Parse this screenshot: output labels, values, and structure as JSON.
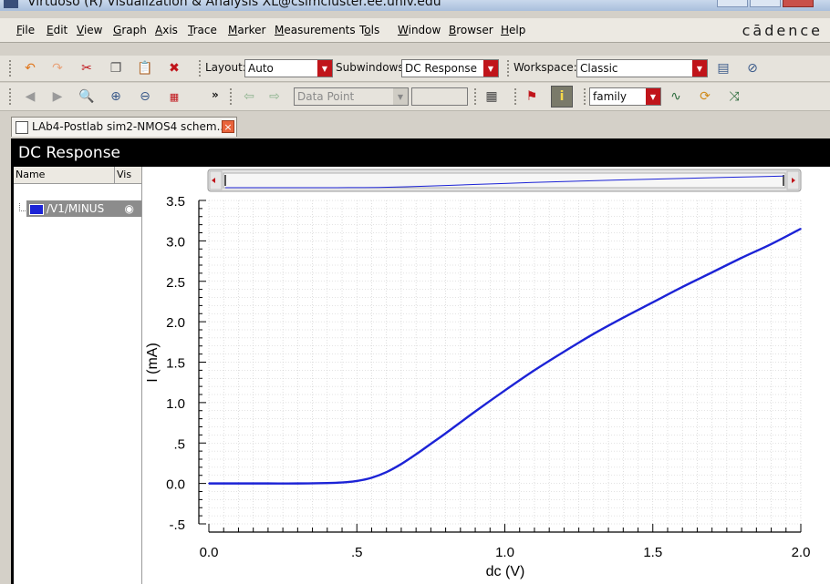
{
  "window": {
    "title": "Virtuoso (R) Visualization & Analysis XL@csimcluster.ee.univ.edu"
  },
  "menubar": {
    "items": [
      {
        "u": "F",
        "rest": "ile"
      },
      {
        "u": "E",
        "rest": "dit"
      },
      {
        "u": "V",
        "rest": "iew"
      },
      {
        "u": "G",
        "rest": "raph"
      },
      {
        "u": "A",
        "rest": "xis"
      },
      {
        "u": "T",
        "rest": "race"
      },
      {
        "u": "M",
        "rest": "arker"
      },
      {
        "u": "M",
        "rest": "easurements",
        "pre": ""
      },
      {
        "u": "o",
        "rest": "ls",
        "pre": "T"
      },
      {
        "u": "W",
        "rest": "indow"
      },
      {
        "u": "B",
        "rest": "rowser"
      },
      {
        "u": "H",
        "rest": "elp"
      }
    ],
    "brand": "cādence"
  },
  "toolbar1": {
    "layout_label": "Layout:",
    "layout_value": "Auto",
    "subwindows_label": "Subwindows:",
    "subwindows_value": "DC Response",
    "workspace_label": "Workspace:",
    "workspace_value": "Classic"
  },
  "toolbar2": {
    "more": "»",
    "marker_mode": "Data Point",
    "marker_value": "",
    "family_value": "family"
  },
  "tab": {
    "label": "LAb4-Postlab sim2-NMOS4 schem..."
  },
  "panel": {
    "title": "DC Response"
  },
  "sidebar": {
    "col_name": "Name",
    "col_vis": "Vis",
    "signal": "/V1/MINUS",
    "signal_color": "#1c23d6"
  },
  "chart_data": {
    "type": "line",
    "xlabel": "dc (V)",
    "ylabel": "I (mA)",
    "xlim": [
      0.0,
      2.0
    ],
    "ylim": [
      -0.5,
      3.5
    ],
    "xticks": [
      {
        "v": 0.0,
        "label": "0.0"
      },
      {
        "v": 0.5,
        "label": ".5"
      },
      {
        "v": 1.0,
        "label": "1.0"
      },
      {
        "v": 1.5,
        "label": "1.5"
      },
      {
        "v": 2.0,
        "label": "2.0"
      }
    ],
    "yticks": [
      {
        "v": 3.5,
        "label": "3.5"
      },
      {
        "v": 3.0,
        "label": "3.0"
      },
      {
        "v": 2.5,
        "label": "2.5"
      },
      {
        "v": 2.0,
        "label": "2.0"
      },
      {
        "v": 1.5,
        "label": "1.5"
      },
      {
        "v": 1.0,
        "label": "1.0"
      },
      {
        "v": 0.5,
        "label": ".5"
      },
      {
        "v": 0.0,
        "label": "0.0"
      },
      {
        "v": -0.5,
        "label": "-.5"
      }
    ],
    "grid": true,
    "series": [
      {
        "name": "/V1/MINUS",
        "color": "#1c23d6",
        "x": [
          0.0,
          0.1,
          0.2,
          0.3,
          0.4,
          0.45,
          0.5,
          0.55,
          0.6,
          0.65,
          0.7,
          0.75,
          0.8,
          0.9,
          1.0,
          1.1,
          1.2,
          1.3,
          1.4,
          1.5,
          1.6,
          1.7,
          1.8,
          1.9,
          2.0
        ],
        "y": [
          0.0,
          0.0,
          0.0,
          0.0,
          0.005,
          0.012,
          0.03,
          0.07,
          0.14,
          0.24,
          0.36,
          0.49,
          0.62,
          0.89,
          1.15,
          1.4,
          1.63,
          1.85,
          2.05,
          2.24,
          2.43,
          2.61,
          2.79,
          2.96,
          3.15
        ]
      }
    ]
  }
}
